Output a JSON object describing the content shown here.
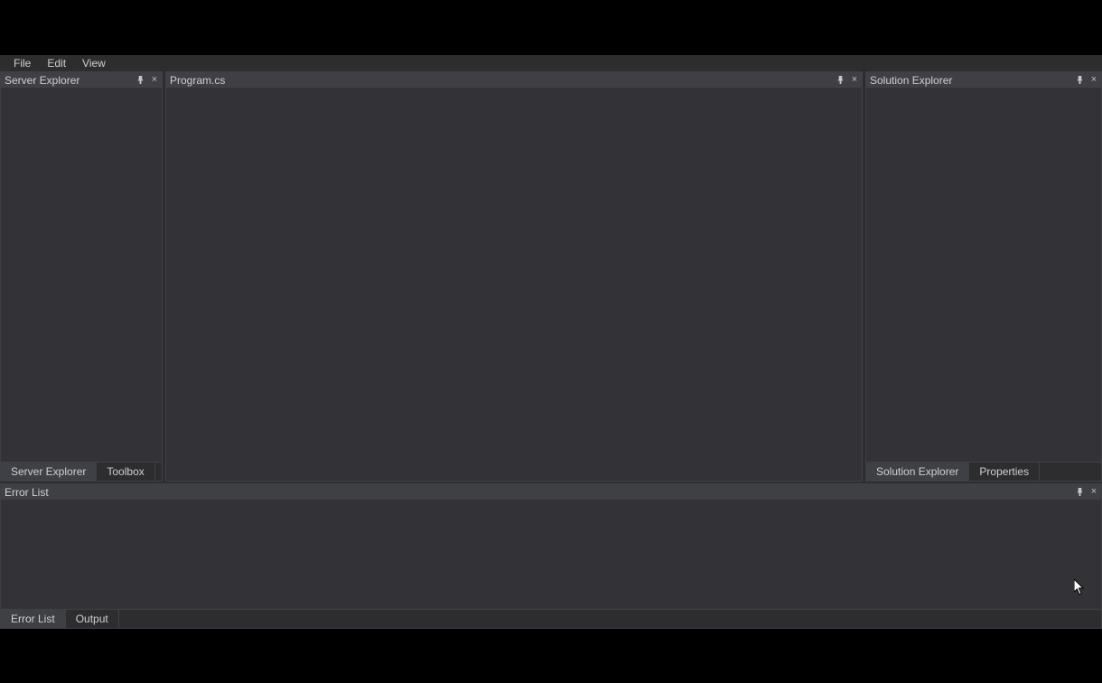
{
  "menu": {
    "file": "File",
    "edit": "Edit",
    "view": "View"
  },
  "left_panel": {
    "title": "Server Explorer",
    "tabs": [
      "Server Explorer",
      "Toolbox"
    ]
  },
  "editor": {
    "title": "Program.cs"
  },
  "right_panel": {
    "title": "Solution Explorer",
    "tabs": [
      "Solution Explorer",
      "Properties"
    ]
  },
  "bottom_panel": {
    "title": "Error List",
    "tabs": [
      "Error List",
      "Output"
    ]
  }
}
